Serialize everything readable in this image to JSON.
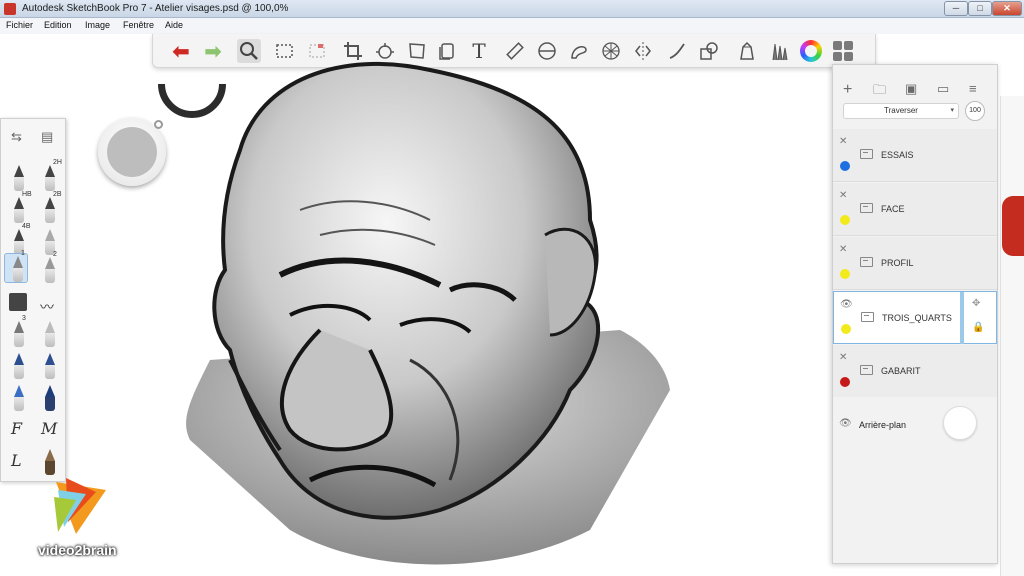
{
  "window": {
    "title": "Autodesk SketchBook Pro 7 - Atelier visages.psd @ 100,0%",
    "min_label": "─",
    "max_label": "□",
    "close_label": "✕"
  },
  "menu": {
    "items": [
      "Fichier",
      "Edition",
      "Image",
      "Fenêtre",
      "Aide"
    ]
  },
  "toolbar": {
    "tools": [
      "undo-icon",
      "redo-icon",
      "zoom-icon",
      "select-icon",
      "crop-select-icon",
      "crop-icon",
      "transform-icon",
      "distort-icon",
      "copy-icon",
      "text-icon",
      "ruler-icon",
      "ellipse-icon",
      "french-curve-icon",
      "perspective-icon",
      "symmetry-icon",
      "line-icon",
      "shapes-icon",
      "copic-icon",
      "brushes-icon",
      "color-wheel-icon",
      "layers-toggle-icon"
    ],
    "text_tool_glyph": "T"
  },
  "brush_palette": {
    "brush_numbers": [
      "",
      "2H",
      "HB",
      "2B",
      "4B",
      "",
      "1",
      "2",
      "",
      "",
      "3",
      "",
      "",
      "",
      "",
      ""
    ],
    "letters": [
      "F",
      "M",
      "L"
    ]
  },
  "layers": {
    "blend_mode": "Traverser",
    "opacity": "100",
    "items": [
      {
        "name": "ESSAIS",
        "color": "#1e6fe0",
        "visible": false,
        "active": false
      },
      {
        "name": "FACE",
        "color": "#f2ea1a",
        "visible": false,
        "active": false
      },
      {
        "name": "PROFIL",
        "color": "#f2ea1a",
        "visible": false,
        "active": false
      },
      {
        "name": "TROIS_QUARTS",
        "color": "#f2ea1a",
        "visible": true,
        "active": true
      },
      {
        "name": "GABARIT",
        "color": "#c41a1a",
        "visible": false,
        "active": false
      }
    ],
    "background_label": "Arrière-plan"
  },
  "watermark": {
    "text": "video2brain"
  },
  "colors": {
    "accent": "#7fb6e3",
    "undo": "#cc2a22",
    "redo": "#8ec46f"
  }
}
